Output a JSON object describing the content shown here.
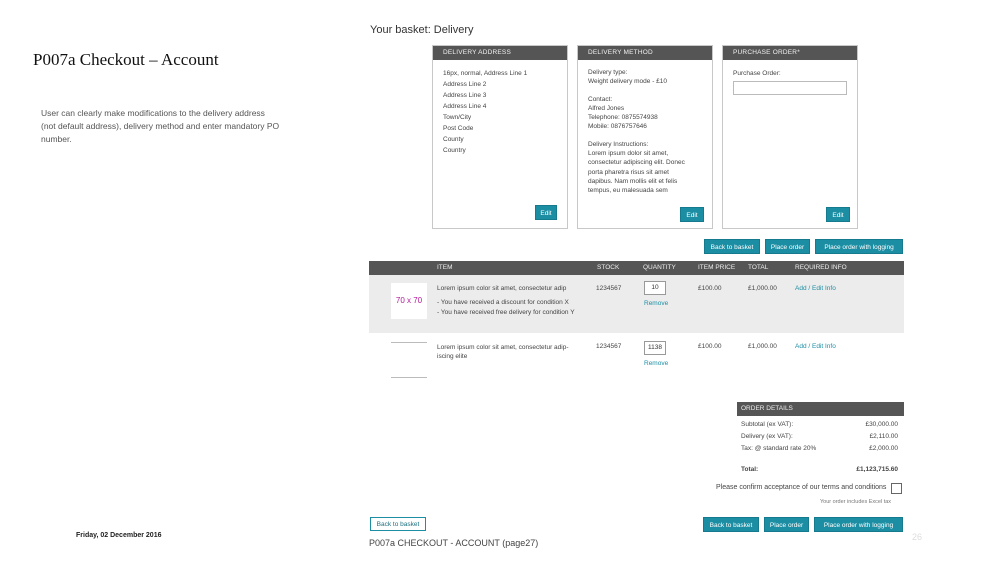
{
  "slide": {
    "title": "P007a Checkout – Account",
    "description": "User can clearly make modifications to the delivery address (not default address), delivery method and enter mandatory PO number.",
    "date": "Friday, 02 December 2016",
    "footer": "P007a CHECKOUT - ACCOUNT (page27)",
    "page_number": "26"
  },
  "basket": {
    "heading": "Your basket: Delivery"
  },
  "delivery_address": {
    "header": "DELIVERY ADDRESS",
    "lines": [
      "16px, normal, Address Line 1",
      "Address Line 2",
      "Address Line 3",
      "Address Line 4",
      "Town/City",
      "Post Code",
      "County",
      "Country"
    ],
    "edit_label": "Edit"
  },
  "delivery_method": {
    "header": "DELIVERY METHOD",
    "type_label": "Delivery type:",
    "type_value": "Weight delivery mode - £10",
    "contact_label": "Contact:",
    "contact_name": "Alfred Jones",
    "telephone": "Telephone: 0875574938",
    "mobile": "Mobile: 0876757646",
    "instructions_label": "Delivery Instructions:",
    "instructions": [
      "Lorem ipsum dolor sit amet,",
      "consectetur adipiscing elit. Donec",
      "porta pharetra risus sit amet",
      "dapibus. Nam mollis elit et felis",
      "tempus, eu malesuada sem"
    ],
    "edit_label": "Edit"
  },
  "purchase_order": {
    "header": "PURCHASE ORDER*",
    "label": "Purchase Order:",
    "value": "",
    "edit_label": "Edit"
  },
  "actions": {
    "back_to_basket": "Back to basket",
    "place_order": "Place order",
    "place_order_logging": "Place order with logging"
  },
  "table": {
    "headers": {
      "item": "ITEM",
      "stock": "STOCK",
      "quantity": "QUANTITY",
      "item_price": "ITEM PRICE",
      "total": "TOTAL",
      "required_info": "REQUIRED INFO"
    },
    "rows": [
      {
        "thumb": "70 x 70",
        "name": "Lorem ipsum color sit amet, consectetur adip",
        "notes": [
          "- You have received a discount for condition X",
          "- You have received free delivery for condition Y"
        ],
        "stock": "1234567",
        "quantity": "10",
        "remove": "Remove",
        "item_price": "£100.00",
        "total": "£1,000.00",
        "required_info": "Add / Edit Info"
      },
      {
        "thumb": "",
        "name": "Lorem ipsum color sit amet, consectetur adip-",
        "name2": "iscing elite",
        "stock": "1234567",
        "quantity": "1138",
        "remove": "Remove",
        "item_price": "£100.00",
        "total": "£1,000.00",
        "required_info": "Add / Edit Info"
      }
    ]
  },
  "order_details": {
    "header": "ORDER DETAILS",
    "subtotal_label": "Subtotal (ex VAT):",
    "subtotal_value": "£30,000.00",
    "delivery_label": "Delivery (ex VAT):",
    "delivery_value": "£2,110.00",
    "tax_label": "Tax: @ standard rate 20%",
    "tax_value": "£2,000.00",
    "total_label": "Total:",
    "total_value": "£1,123,715.60"
  },
  "terms": {
    "label": "Please confirm acceptance of our terms and conditions",
    "legal_note": "Your order includes Excel tax"
  },
  "bottom": {
    "back_to_basket": "Back to basket",
    "place_order": "Place order",
    "place_order_logging": "Place order with logging"
  }
}
